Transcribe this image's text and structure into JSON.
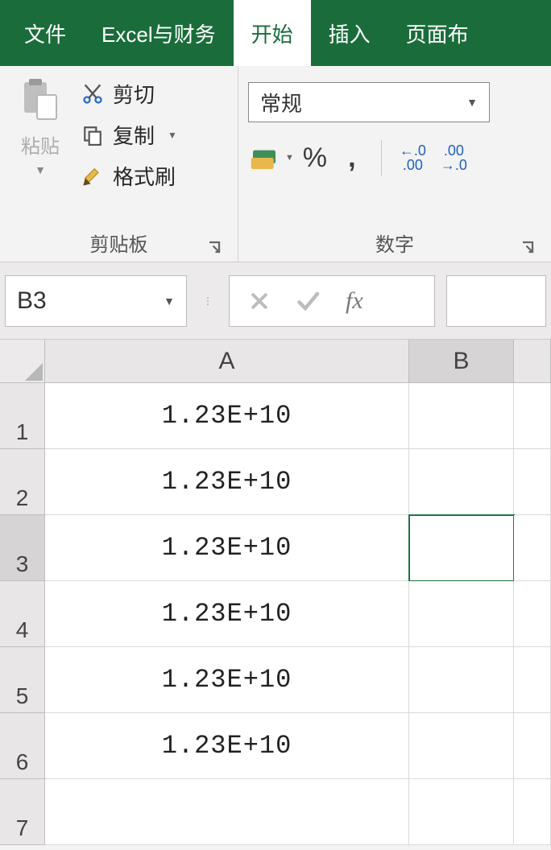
{
  "tabs": {
    "file": "文件",
    "custom": "Excel与财务",
    "home": "开始",
    "insert": "插入",
    "page": "页面布"
  },
  "ribbon": {
    "paste_label": "粘贴",
    "cut": "剪切",
    "copy": "复制",
    "format_painter": "格式刷",
    "clipboard_group": "剪贴板",
    "number_format": "常规",
    "number_group": "数字",
    "percent": "%",
    "comma": ",",
    "inc_dec": "←.0\n.00",
    "dec_inc": ".00\n→.0"
  },
  "namebox": "B3",
  "fx": "fx",
  "columns": [
    "A",
    "B"
  ],
  "rows": [
    {
      "n": "1",
      "a": "1.23E+10",
      "b": ""
    },
    {
      "n": "2",
      "a": "1.23E+10",
      "b": ""
    },
    {
      "n": "3",
      "a": "1.23E+10",
      "b": ""
    },
    {
      "n": "4",
      "a": "1.23E+10",
      "b": ""
    },
    {
      "n": "5",
      "a": "1.23E+10",
      "b": ""
    },
    {
      "n": "6",
      "a": "1.23E+10",
      "b": ""
    },
    {
      "n": "7",
      "a": "",
      "b": ""
    }
  ],
  "selected": {
    "col": "B",
    "row": "3"
  }
}
